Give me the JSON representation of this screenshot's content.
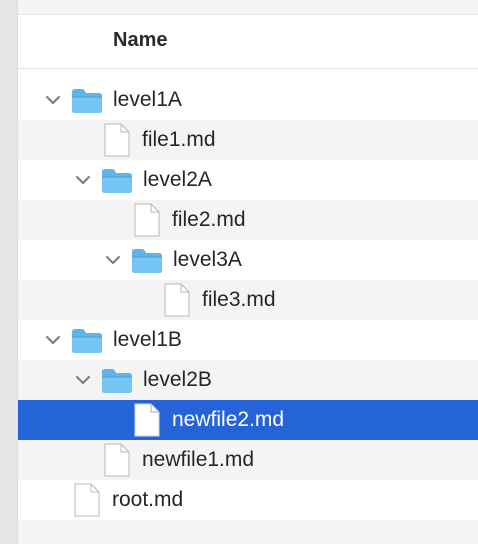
{
  "header": {
    "name_column": "Name"
  },
  "rows": [
    {
      "label": "level1A",
      "kind": "folder",
      "expanded": true
    },
    {
      "label": "file1.md",
      "kind": "file"
    },
    {
      "label": "level2A",
      "kind": "folder",
      "expanded": true
    },
    {
      "label": "file2.md",
      "kind": "file"
    },
    {
      "label": "level3A",
      "kind": "folder",
      "expanded": true
    },
    {
      "label": "file3.md",
      "kind": "file"
    },
    {
      "label": "level1B",
      "kind": "folder",
      "expanded": true
    },
    {
      "label": "level2B",
      "kind": "folder",
      "expanded": true
    },
    {
      "label": "newfile2.md",
      "kind": "file",
      "selected": true
    },
    {
      "label": "newfile1.md",
      "kind": "file"
    },
    {
      "label": "root.md",
      "kind": "file"
    }
  ],
  "icons": {
    "folder": "folder-icon",
    "file": "document-icon",
    "chevron": "chevron-down-icon"
  },
  "colors": {
    "selection": "#2563d8",
    "folder": "#5fb4ea",
    "alternate_row": "#f4f4f4"
  }
}
